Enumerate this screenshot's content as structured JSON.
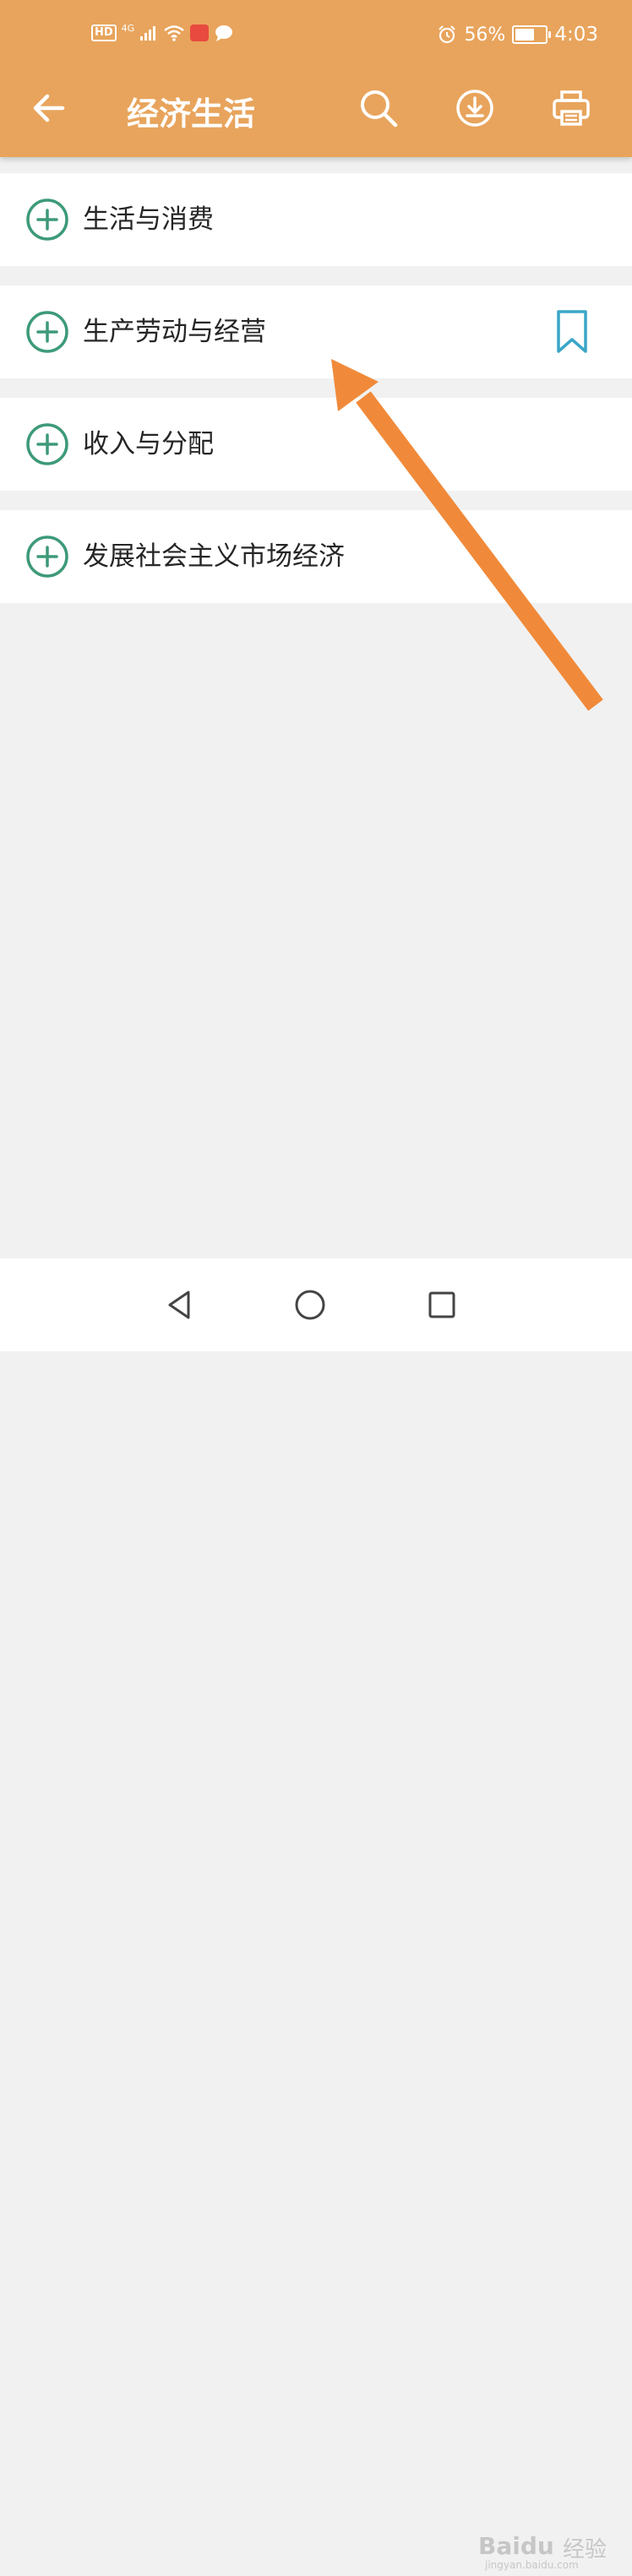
{
  "status_bar": {
    "hd": "HD",
    "network": "4G",
    "battery_percent": "56%",
    "battery_level": 0.56,
    "time": "4:03"
  },
  "app_bar": {
    "title": "经济生活",
    "color": "#e8a45c"
  },
  "sections": [
    {
      "label": "生活与消费",
      "bookmarked": false
    },
    {
      "label": "生产劳动与经营",
      "bookmarked": true
    },
    {
      "label": "收入与分配",
      "bookmarked": false
    },
    {
      "label": "发展社会主义市场经济",
      "bookmarked": false
    }
  ],
  "colors": {
    "accent_green": "#3d9a78",
    "bookmark_blue": "#3aa6c7",
    "annotation_arrow": "#f08a3a"
  },
  "watermark": {
    "brand": "Baidu",
    "text": "经验",
    "url": "jingyan.baidu.com"
  }
}
